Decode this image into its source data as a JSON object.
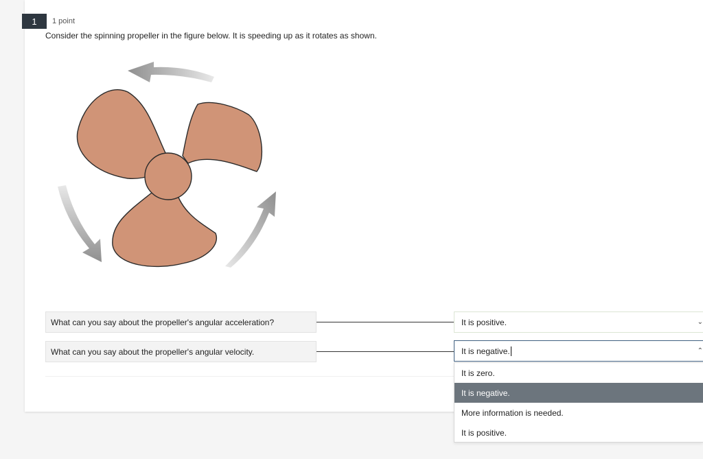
{
  "question": {
    "number": "1",
    "points": "1 point",
    "prompt": "Consider the spinning propeller in the figure below. It is speeding up as it rotates as shown."
  },
  "matching": [
    {
      "prompt": "What can you say about the propeller's angular acceleration?",
      "selected": "It is positive."
    },
    {
      "prompt": "What can you say about the propeller's angular velocity.",
      "selected": "It is negative."
    }
  ],
  "dropdown": {
    "options": [
      "It is zero.",
      "It is negative.",
      "More information is needed.",
      "It is positive."
    ],
    "highlighted_index": 1
  },
  "icons": {
    "figure": "propeller-figure",
    "rotation_arrows": "curved-arrow-icon",
    "select_chevron": "chevron-icon"
  },
  "colors": {
    "propeller": "#d09477",
    "arrow": "#a6a6a6",
    "question_badge": "#2e3740",
    "option_highlight": "#6c757d"
  }
}
